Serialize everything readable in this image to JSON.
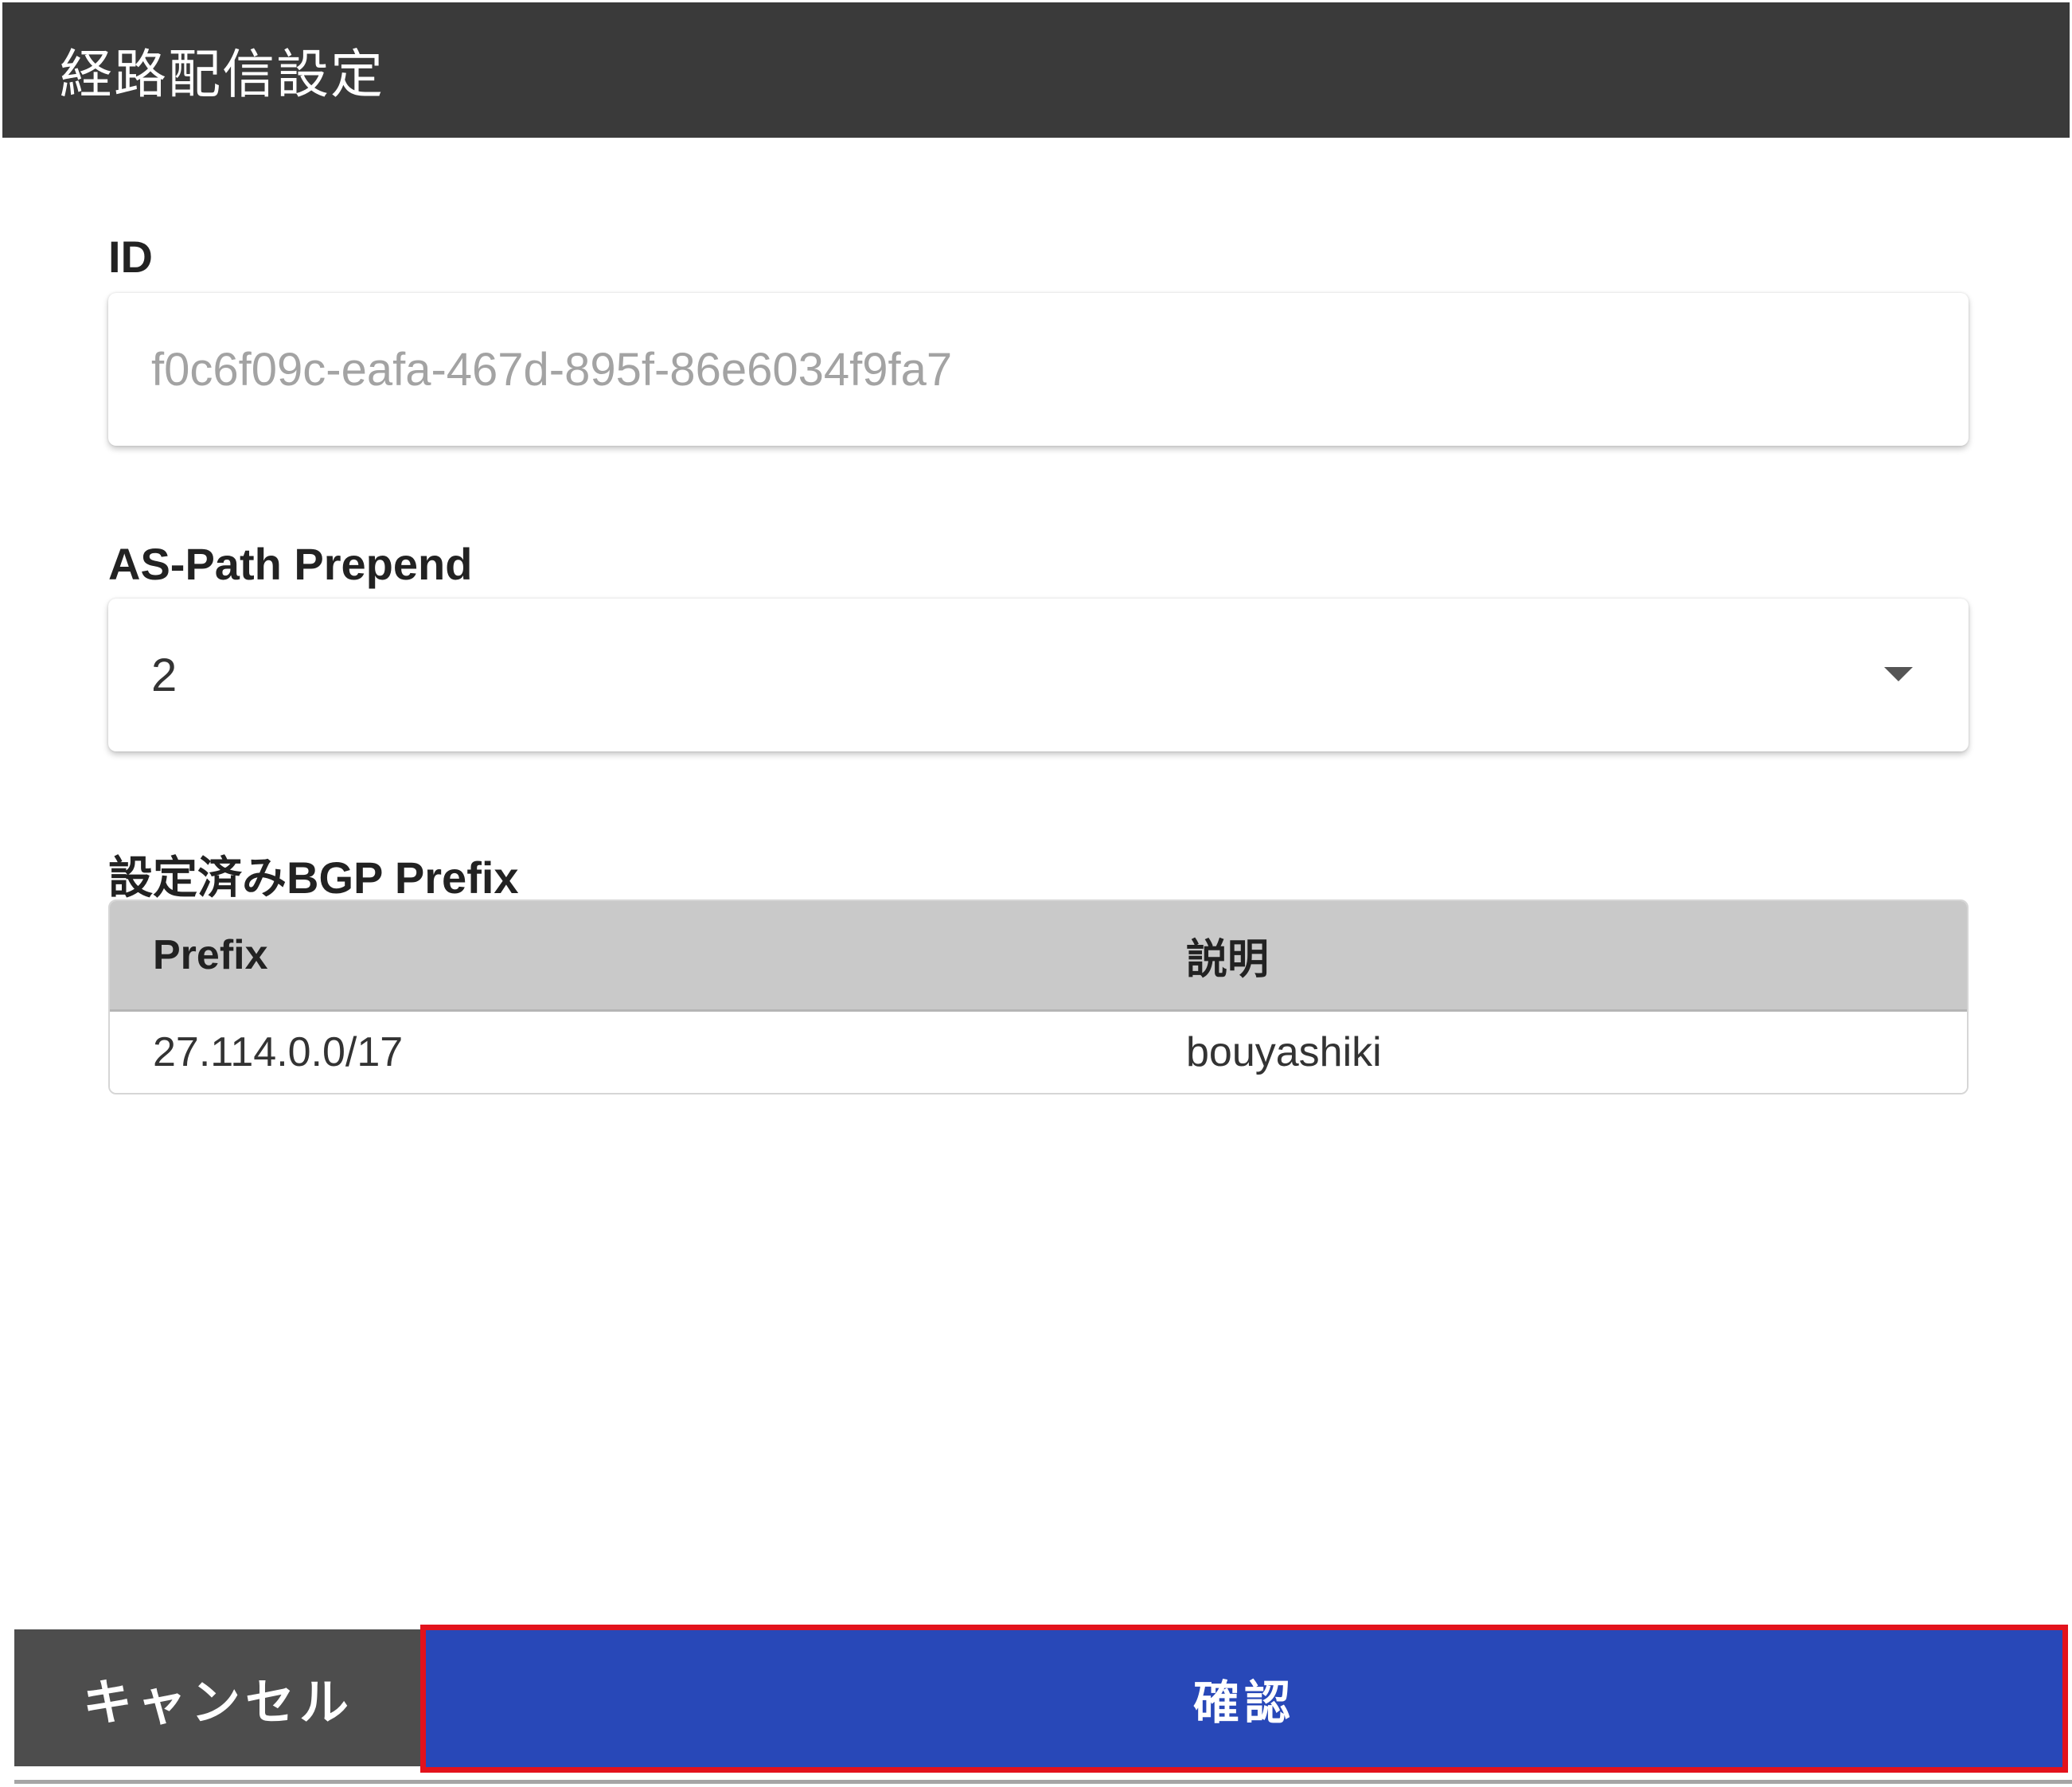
{
  "header": {
    "title": "経路配信設定"
  },
  "id_field": {
    "label": "ID",
    "value": "f0c6f09c-eafa-467d-895f-86e6034f9fa7"
  },
  "as_path_prepend": {
    "label": "AS-Path Prepend",
    "selected_value": "2",
    "icon": "chevron-down-icon"
  },
  "bgp_prefix": {
    "label": "設定済みBGP Prefix",
    "columns": [
      "Prefix",
      "説明"
    ],
    "rows": [
      [
        "27.114.0.0/17",
        "bouyashiki"
      ]
    ]
  },
  "footer": {
    "cancel_label": "キャンセル",
    "confirm_label": "確認"
  },
  "colors": {
    "header_bg": "#3a3a3a",
    "confirm_bg": "#2848b8",
    "cancel_bg": "#4d4d4d",
    "highlight_border": "#e3121c"
  }
}
